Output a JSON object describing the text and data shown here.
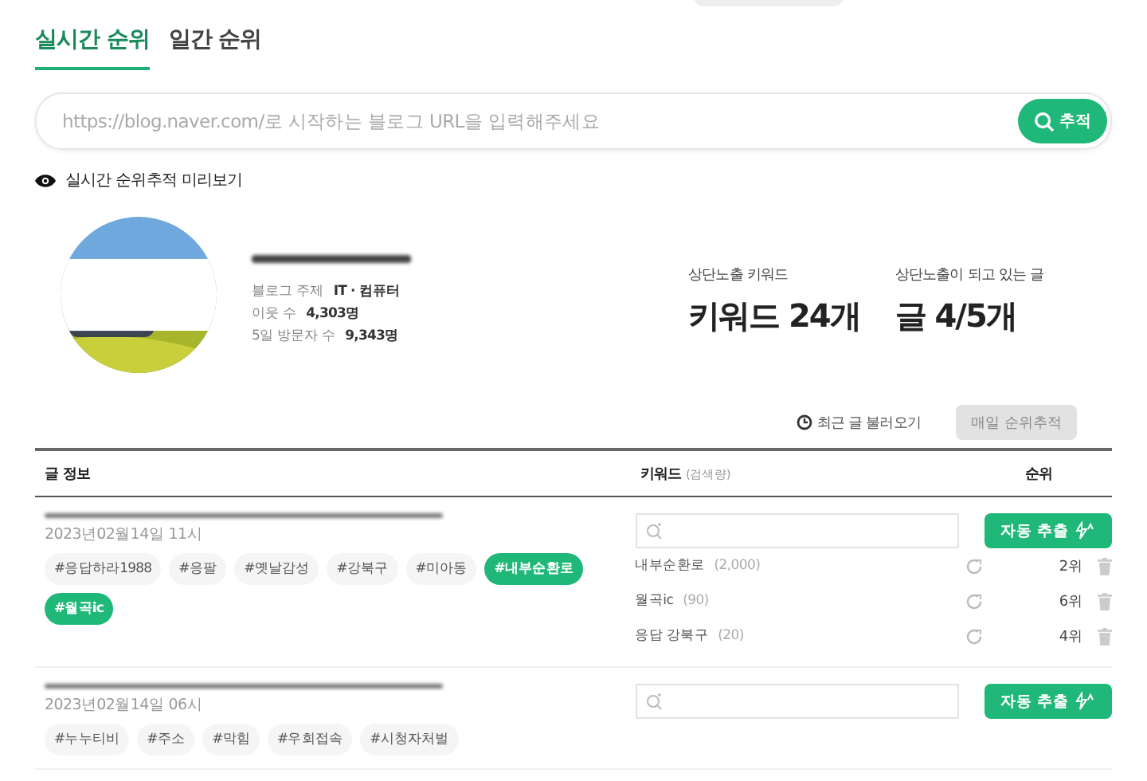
{
  "tabs": [
    {
      "label": "실시간 순위",
      "selected": true
    },
    {
      "label": "일간 순위",
      "selected": false
    }
  ],
  "search": {
    "placeholder": "https://blog.naver.com/로 시작하는 블로그 URL을 입력해주세요",
    "button": "추적"
  },
  "preview_label": "실시간 순위추적 미리보기",
  "profile": {
    "stats": [
      {
        "label": "블로그 주제",
        "value": "IT · 컴퓨터"
      },
      {
        "label": "이웃 수",
        "value": "4,303명"
      },
      {
        "label": "5일 방문자 수",
        "value": "9,343명"
      }
    ]
  },
  "summary": [
    {
      "label": "상단노출 키워드",
      "value": "키워드 24개"
    },
    {
      "label": "상단노출이 되고 있는 글",
      "value": "글 4/5개"
    }
  ],
  "actions": {
    "recent": "최근 글 불러오기",
    "track": "매일 순위추적",
    "track_disabled": true
  },
  "table": {
    "columns": [
      {
        "label": "글 정보"
      },
      {
        "label": "키워드",
        "sub": "(검색량)"
      },
      {
        "label": "순위"
      }
    ],
    "rows": [
      {
        "date": "2023년02월14일 11시",
        "tags": [
          {
            "label": "#응답하라1988",
            "selected": false
          },
          {
            "label": "#응팔",
            "selected": false
          },
          {
            "label": "#옛날감성",
            "selected": false
          },
          {
            "label": "#강북구",
            "selected": false
          },
          {
            "label": "#미아동",
            "selected": false
          },
          {
            "label": "#내부순환로",
            "selected": true
          },
          {
            "label": "#월곡ic",
            "selected": true
          }
        ],
        "button": "자동 추출",
        "keywords": [
          {
            "name": "내부순환로",
            "volume": "(2,000)",
            "rank": "2위"
          },
          {
            "name": "월곡ic",
            "volume": "(90)",
            "rank": "6위"
          },
          {
            "name": "응답 강북구",
            "volume": "(20)",
            "rank": "4위"
          }
        ]
      },
      {
        "date": "2023년02월14일 06시",
        "tags": [
          {
            "label": "#누누티비",
            "selected": false
          },
          {
            "label": "#주소",
            "selected": false
          },
          {
            "label": "#막힘",
            "selected": false
          },
          {
            "label": "#우회접속",
            "selected": false
          },
          {
            "label": "#시청자처벌",
            "selected": false
          }
        ],
        "button": "자동 추출",
        "keywords": []
      }
    ]
  }
}
